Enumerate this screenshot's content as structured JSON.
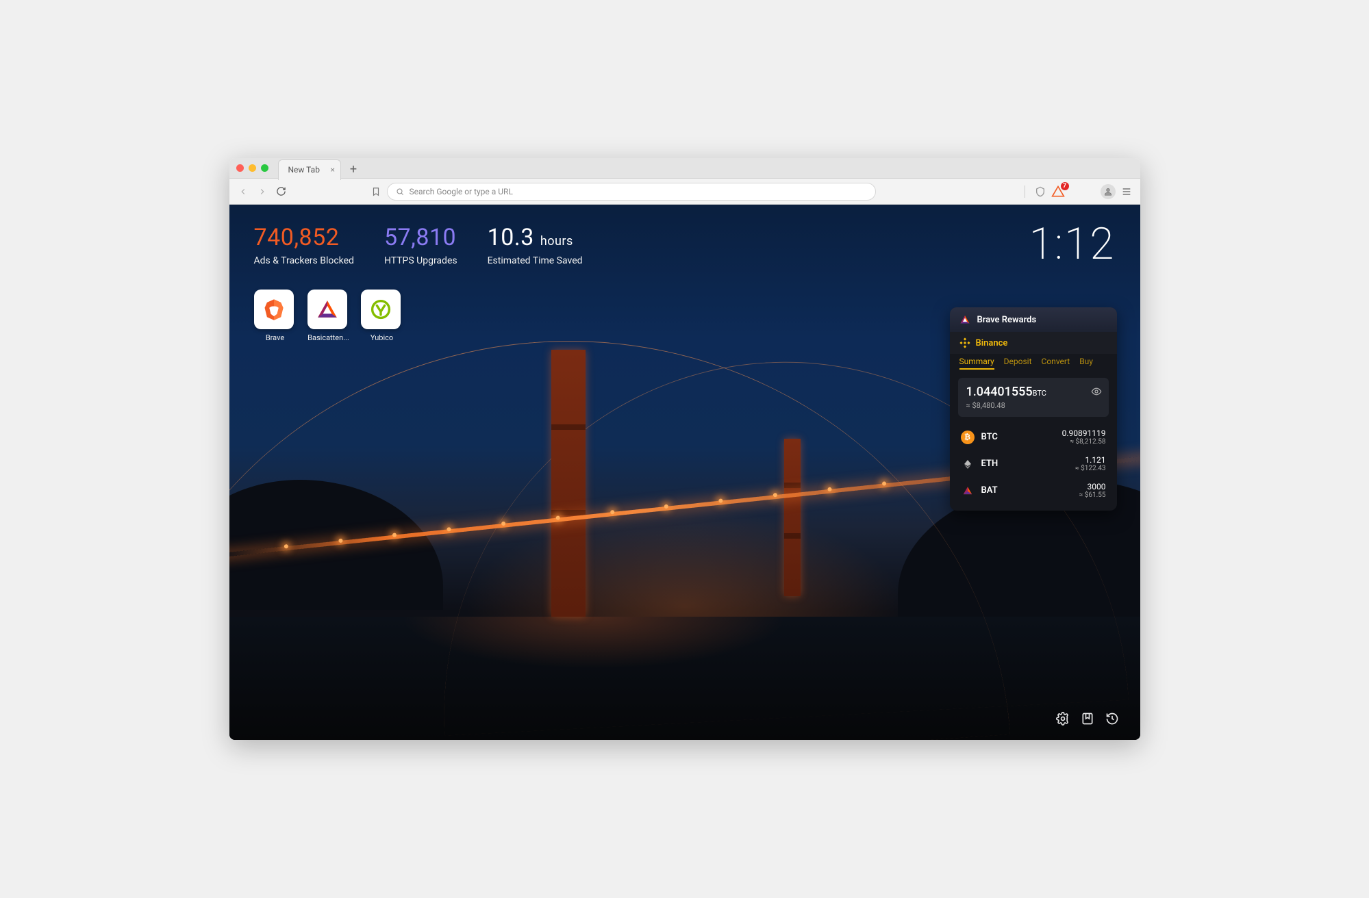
{
  "tab": {
    "title": "New Tab"
  },
  "omnibox": {
    "placeholder": "Search Google or type a URL"
  },
  "toolbar_badge": "7",
  "stats": {
    "ads": {
      "value": "740,852",
      "label": "Ads & Trackers Blocked"
    },
    "https": {
      "value": "57,810",
      "label": "HTTPS Upgrades"
    },
    "time": {
      "value": "10.3",
      "unit": "hours",
      "label": "Estimated Time Saved"
    }
  },
  "topsites": [
    {
      "label": "Brave"
    },
    {
      "label": "Basicatten..."
    },
    {
      "label": "Yubico"
    }
  ],
  "clock": "1:12",
  "rewards": {
    "title": "Brave Rewards"
  },
  "binance": {
    "name": "Binance",
    "tabs": [
      "Summary",
      "Deposit",
      "Convert",
      "Buy"
    ],
    "active_tab": 0,
    "balance": {
      "amount": "1.04401555",
      "unit": "BTC",
      "fiat": "≈ $8,480.48"
    },
    "assets": [
      {
        "sym": "BTC",
        "amount": "0.90891119",
        "fiat": "≈ $8,212.58"
      },
      {
        "sym": "ETH",
        "amount": "1.121",
        "fiat": "≈ $122.43"
      },
      {
        "sym": "BAT",
        "amount": "3000",
        "fiat": "≈ $61.55"
      }
    ]
  }
}
